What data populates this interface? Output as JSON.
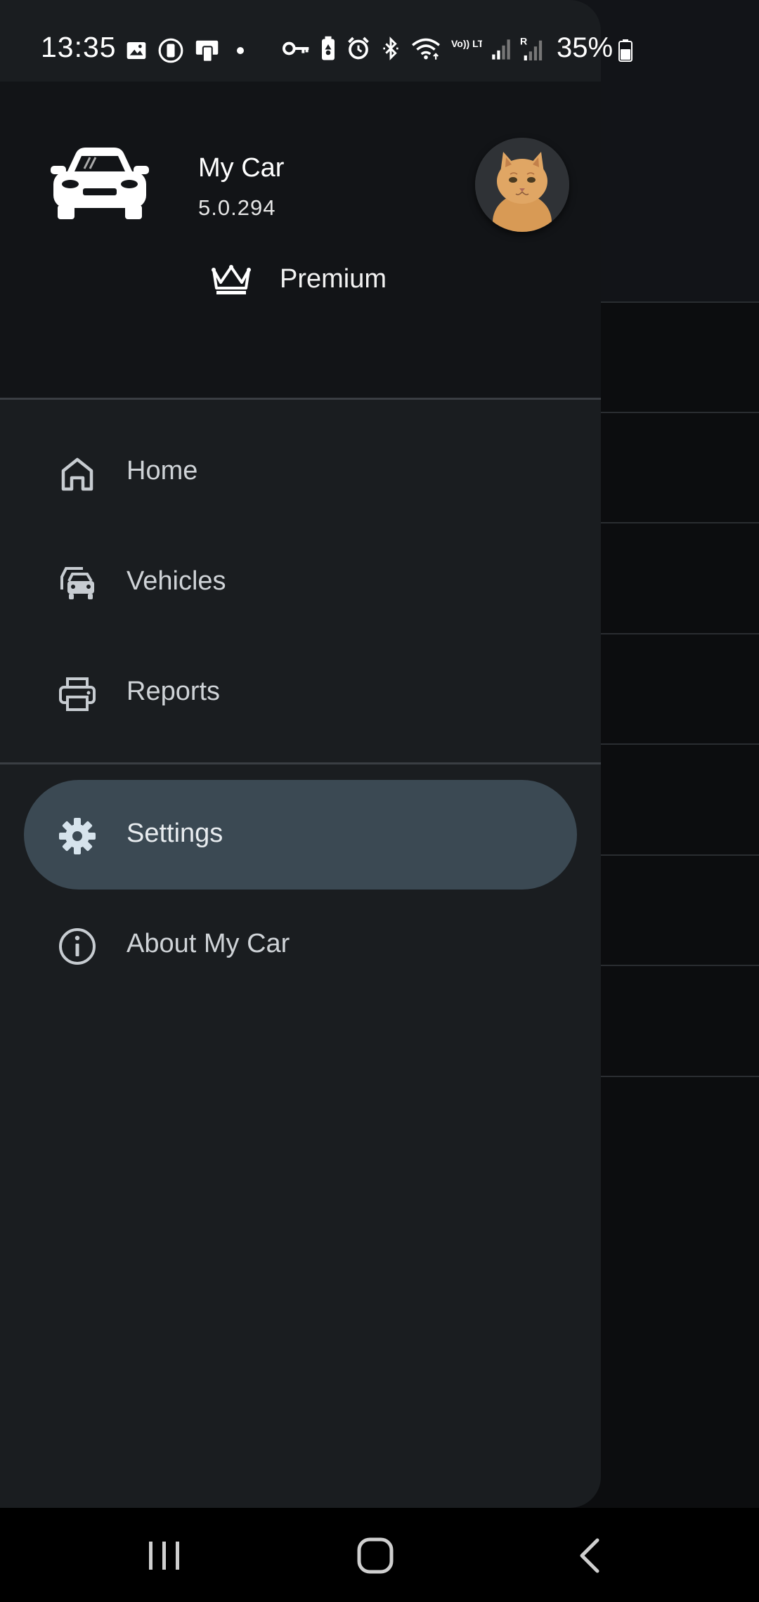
{
  "status_bar": {
    "time": "13:35",
    "battery_percent": "35%",
    "network_label": "Vo)) LTE1",
    "roaming_label": "R",
    "icons": [
      "gallery-icon",
      "screen-record-icon",
      "phone-sync-icon",
      "dot-icon",
      "vpn-key-icon",
      "battery-saver-icon",
      "alarm-icon",
      "bluetooth-icon",
      "wifi-icon",
      "signal-icon",
      "signal-roaming-icon",
      "battery-icon"
    ]
  },
  "header": {
    "app_name": "My Car",
    "version": "5.0.294",
    "premium_label": "Premium"
  },
  "menu": {
    "items": [
      {
        "label": "Home",
        "icon": "home-icon"
      },
      {
        "label": "Vehicles",
        "icon": "vehicles-icon"
      },
      {
        "label": "Reports",
        "icon": "printer-icon"
      },
      {
        "label": "Settings",
        "icon": "gear-icon",
        "active": true
      },
      {
        "label": "About My Car",
        "icon": "info-icon"
      }
    ]
  },
  "colors": {
    "drawer_bg": "#1a1d20",
    "header_bg": "#121417",
    "active_pill": "#3b4953",
    "text": "#cfd3d7"
  }
}
